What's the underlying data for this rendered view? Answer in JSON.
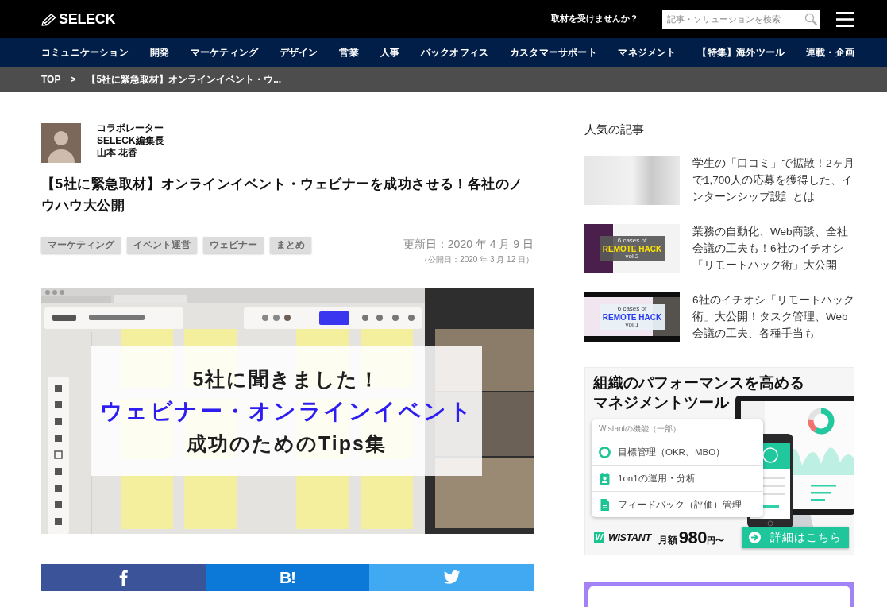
{
  "header": {
    "logo": "SELECK",
    "interview_link": "取材を受けませんか？",
    "search": {
      "placeholder": "記事・ソリューションを検索"
    }
  },
  "category_nav": [
    "コミュニケーション",
    "開発",
    "マーケティング",
    "デザイン",
    "営業",
    "人事",
    "バックオフィス",
    "カスタマーサポート",
    "マネジメント",
    "【特集】海外ツール",
    "連載・企画"
  ],
  "breadcrumb": {
    "home": "TOP",
    "separator": ">",
    "current": "【5社に緊急取材】オンラインイベント・ウ..."
  },
  "article": {
    "author": {
      "role": "コラボレーター",
      "position": "SELECK編集長",
      "name": "山本 花香"
    },
    "title": "【5社に緊急取材】オンラインイベント・ウェビナーを成功させる！各社のノウハウ大公開",
    "tags": [
      "マーケティング",
      "イベント運営",
      "ウェビナー",
      "まとめ"
    ],
    "updated": "更新日：2020 年 4 月 9 日",
    "published": "（公開日：2020 年 3 月 12 日）",
    "hero": {
      "headline": [
        {
          "text": "5社に聞きました！",
          "kind": "plain"
        },
        {
          "text": "ウェビナー・オンラインイベント",
          "kind": "highlight"
        },
        {
          "text": "成功のためのTips集",
          "kind": "plain"
        }
      ]
    }
  },
  "share": [
    {
      "kind": "facebook"
    },
    {
      "kind": "hatena",
      "label": "B!"
    },
    {
      "kind": "twitter"
    }
  ],
  "sidebar": {
    "heading": "人気の記事",
    "articles": [
      {
        "title": "学生の「口コミ」で拡散！2ヶ月で1,700人の応募を獲得した、インターンシップ設計とは",
        "thumb": {
          "kind": "photo"
        }
      },
      {
        "title": "業務の自動化、Web商談、全社会議の工夫も！6社のイチオシ「リモートハック術」大公開",
        "thumb": {
          "kind": "dark_slide",
          "lines": [
            "6 cases of",
            "REMOTE HACK",
            "vol.2"
          ]
        }
      },
      {
        "title": "6社のイチオシ「リモートハック術」大公開！タスク管理、Web会議の工夫、各種手当も",
        "thumb": {
          "kind": "light_slide",
          "lines": [
            "6 cases of",
            "REMOTE HACK",
            "vol.1"
          ]
        }
      }
    ]
  },
  "ad": {
    "heading_lines": [
      "組織のパフォーマンスを高める",
      "マネジメントツール"
    ],
    "features_title": "Wistantの機能（一部）",
    "features": [
      {
        "kind": "goal",
        "label": "目標管理（OKR、MBO）"
      },
      {
        "kind": "meeting",
        "label": "1on1の運用・分析"
      },
      {
        "kind": "feedback",
        "label": "フィードバック（評価）管理"
      }
    ],
    "brand_mark": "W",
    "brand": "WiSTANT",
    "price": {
      "prefix": "月額",
      "amount": "980",
      "suffix": "円〜"
    },
    "cta": "詳細はこちら"
  }
}
